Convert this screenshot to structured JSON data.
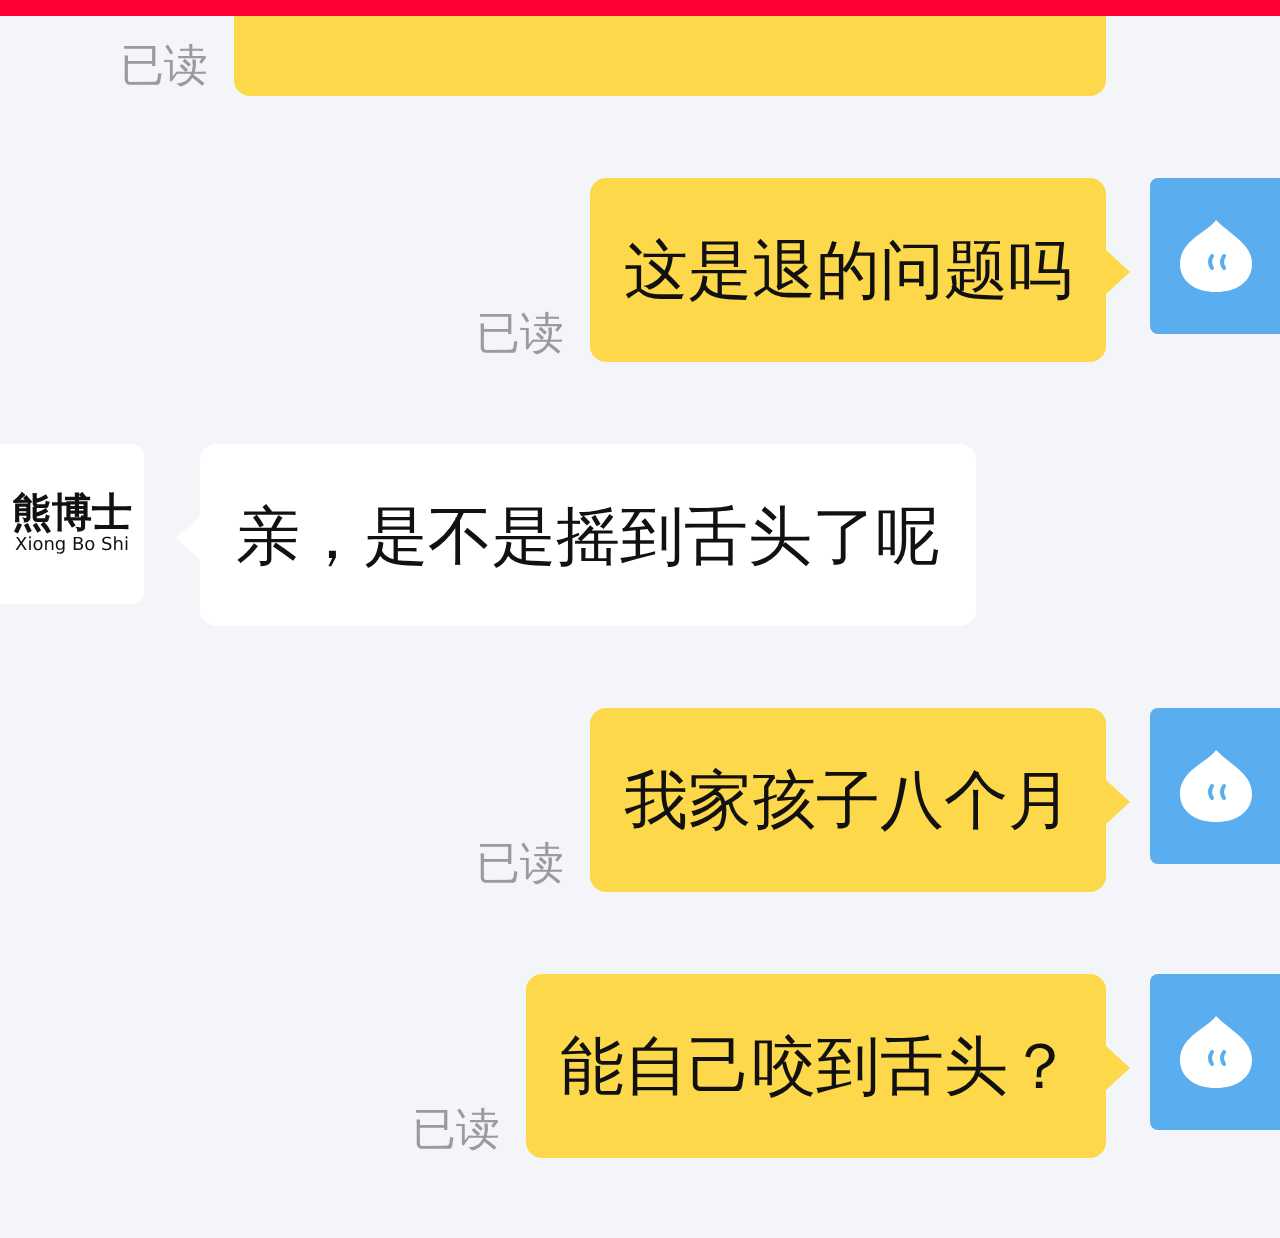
{
  "messages": [
    {
      "kind": "sent",
      "read_status": "已读",
      "cut_off": true
    },
    {
      "kind": "sent",
      "text": "这是退的问题吗",
      "read_status": "已读"
    },
    {
      "kind": "received",
      "text": "亲，是不是摇到舌头了呢",
      "avatar": {
        "name": "熊博士",
        "subtitle": "Xiong Bo Shi"
      }
    },
    {
      "kind": "sent",
      "text": "我家孩子八个月",
      "read_status": "已读"
    },
    {
      "kind": "sent",
      "text": "能自己咬到舌头？",
      "read_status": "已读"
    }
  ]
}
